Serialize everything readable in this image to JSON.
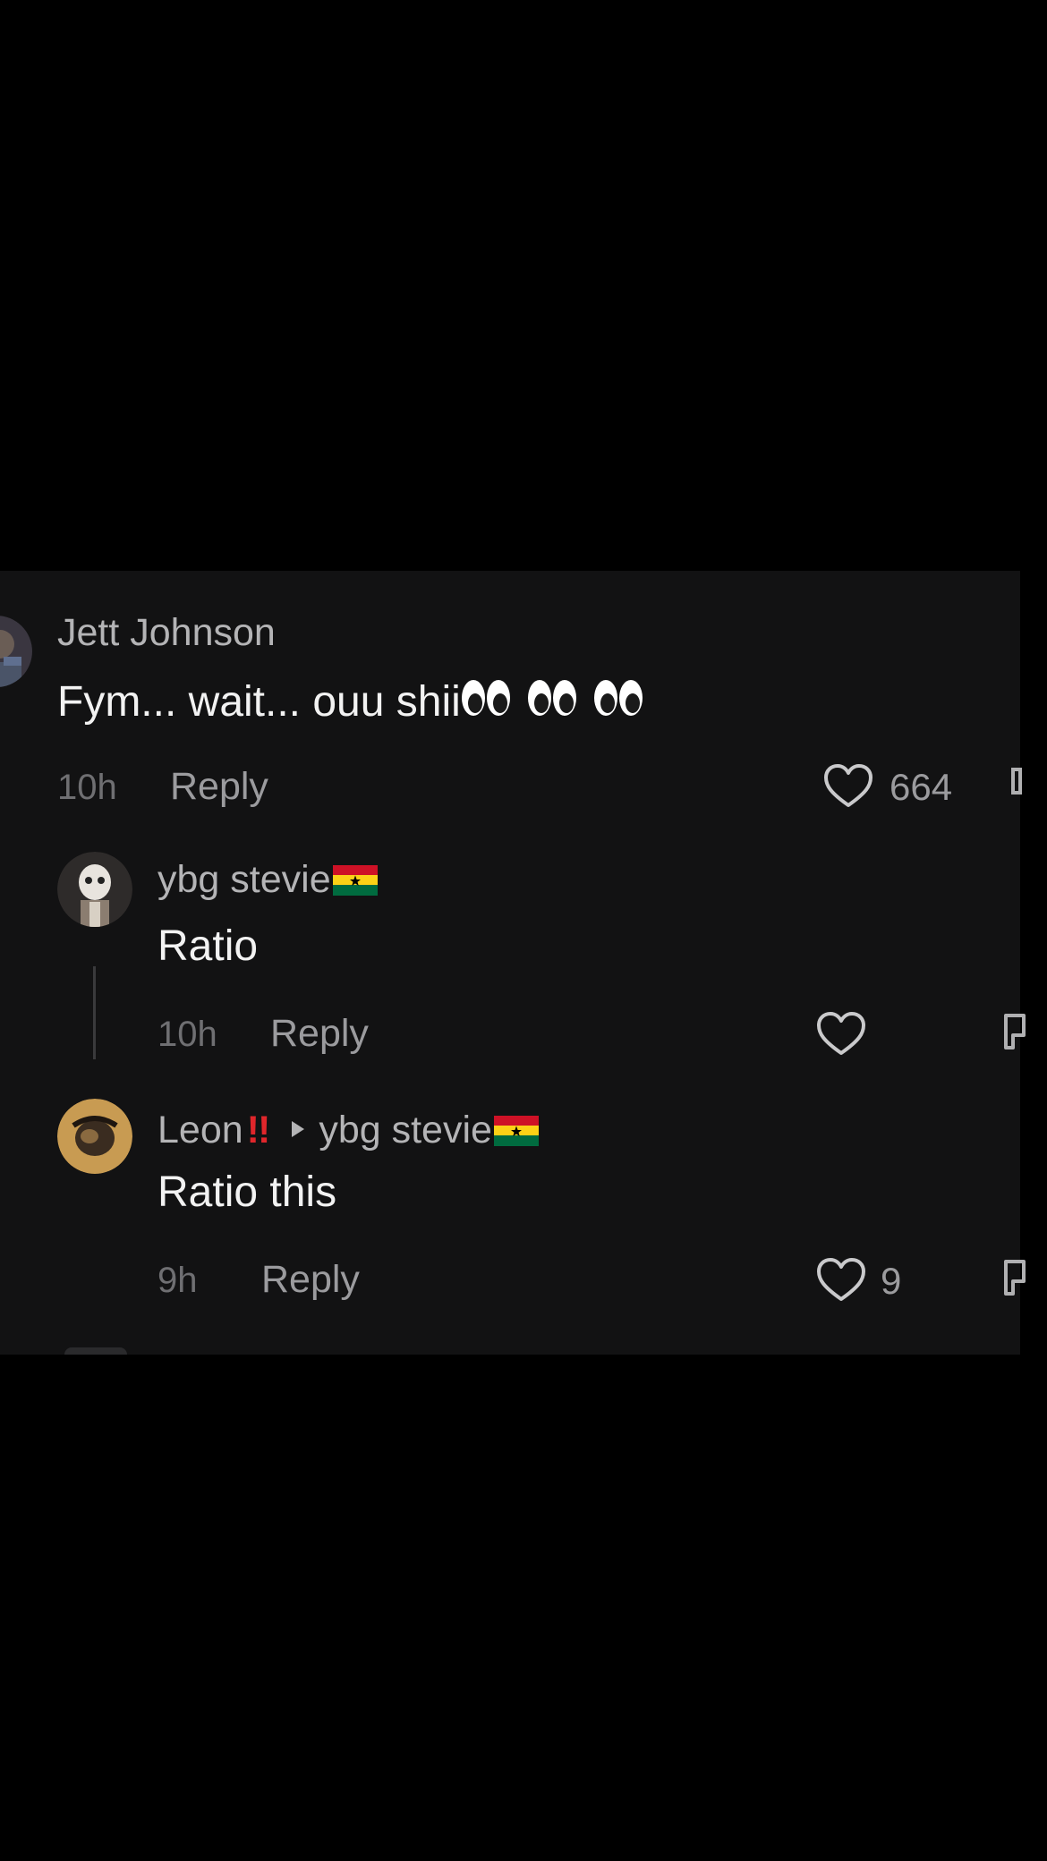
{
  "comments": [
    {
      "username": "Jett Johnson",
      "text": "Fym... wait... ouu shii",
      "emoji": "eyes",
      "time": "10h",
      "reply_label": "Reply",
      "likes": "664"
    },
    {
      "username": "ybg stevie",
      "flag": "ghana-flag",
      "text": "Ratio",
      "time": "10h",
      "reply_label": "Reply",
      "likes": ""
    },
    {
      "username": "Leon",
      "badge": "!!",
      "reply_to": "ybg stevie",
      "flag": "ghana-flag",
      "text": "Ratio this",
      "time": "9h",
      "reply_label": "Reply",
      "likes": "9"
    }
  ],
  "colors": {
    "background": "#000000",
    "panel": "#121213",
    "username": "#b4b4b6",
    "text": "#f2f2f2",
    "meta": "#9b9b9e",
    "badge": "#e0262b"
  }
}
